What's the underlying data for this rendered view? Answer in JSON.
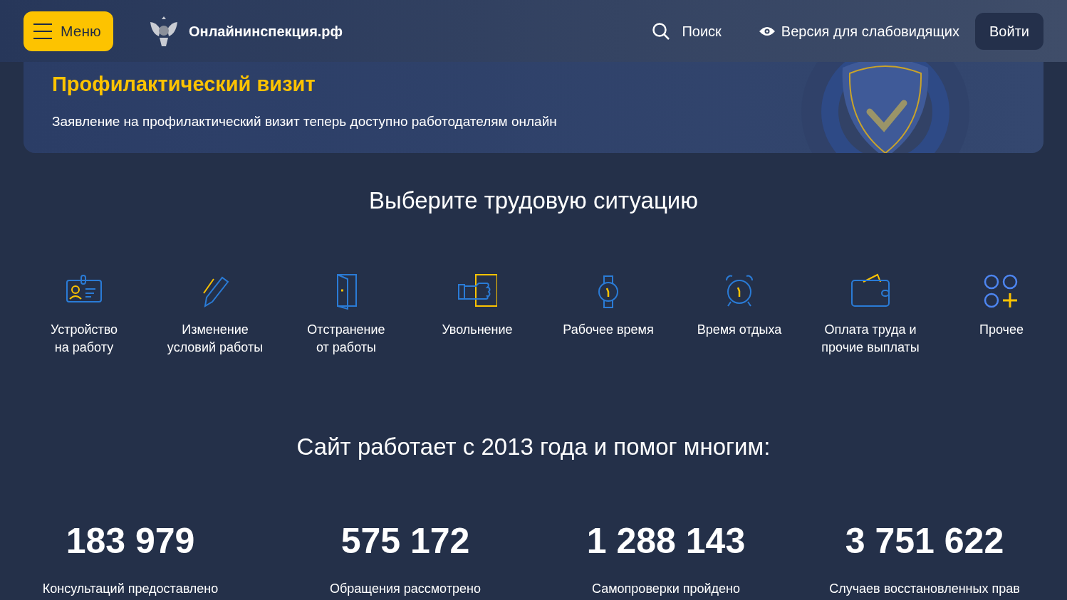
{
  "header": {
    "menu_button": "Меню",
    "site_name": "Онлайнинспекция.рф",
    "search": "Поиск",
    "accessibility": "Версия для слабовидящих",
    "login": "Войти"
  },
  "banner": {
    "title": "Профилактический визит",
    "text": "Заявление на профилактический визит теперь доступно работодателям онлайн"
  },
  "situations_heading": "Выберите трудовую ситуацию",
  "situations": [
    {
      "kind": "badge",
      "label": "Устройство\nна работу"
    },
    {
      "kind": "pen",
      "label": "Изменение\nусловий работы"
    },
    {
      "kind": "door",
      "label": "Отстранение\nот работы"
    },
    {
      "kind": "hand",
      "label": "Увольнение"
    },
    {
      "kind": "watch",
      "label": "Рабочее время"
    },
    {
      "kind": "alarm",
      "label": "Время отдыха"
    },
    {
      "kind": "wallet",
      "label": "Оплата труда и\nпрочие выплаты"
    },
    {
      "kind": "other",
      "label": "Прочее"
    }
  ],
  "stats_heading": "Сайт работает с 2013 года и помог многим:",
  "stats": [
    {
      "value": "183 979",
      "label": "Консультаций предоставлено"
    },
    {
      "value": "575 172",
      "label": "Обращения рассмотрено"
    },
    {
      "value": "1 288 143",
      "label": "Самопроверки пройдено"
    },
    {
      "value": "3 751 622",
      "label": "Случаев восстановленных прав"
    }
  ]
}
